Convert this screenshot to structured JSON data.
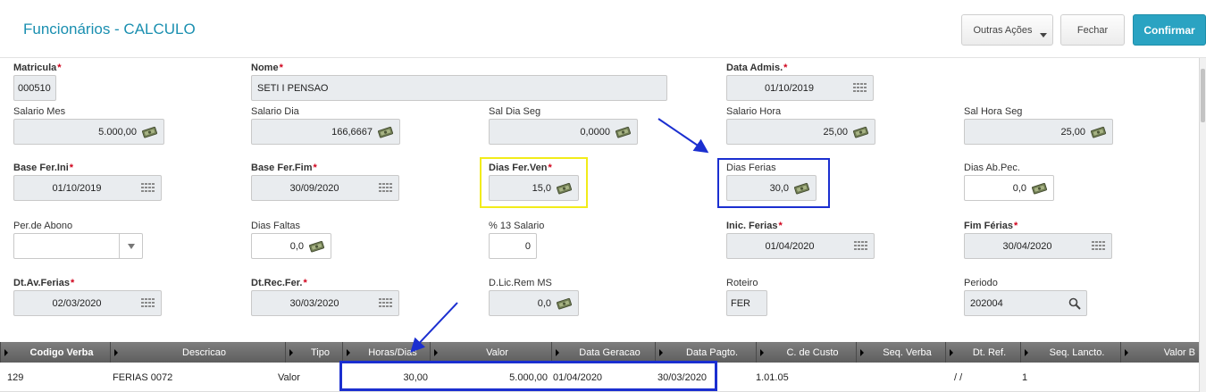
{
  "header": {
    "title": "Funcionários - CALCULO",
    "btn_outras": "Outras Ações",
    "btn_fechar": "Fechar",
    "btn_confirmar": "Confirmar",
    "accent": "#1a8fb0"
  },
  "fields": {
    "matricula": {
      "label": "Matricula",
      "value": "000510"
    },
    "nome": {
      "label": "Nome",
      "value": "SETI I PENSAO"
    },
    "data_admis": {
      "label": "Data Admis.",
      "value": "01/10/2019"
    },
    "salario_mes": {
      "label": "Salario Mes",
      "value": "5.000,00"
    },
    "salario_dia": {
      "label": "Salario Dia",
      "value": "166,6667"
    },
    "sal_dia_seg": {
      "label": "Sal Dia Seg",
      "value": "0,0000"
    },
    "salario_hora": {
      "label": "Salario Hora",
      "value": "25,00"
    },
    "sal_hora_seg": {
      "label": "Sal Hora Seg",
      "value": "25,00"
    },
    "base_fer_ini": {
      "label": "Base Fer.Ini",
      "value": "01/10/2019"
    },
    "base_fer_fim": {
      "label": "Base Fer.Fim",
      "value": "30/09/2020"
    },
    "dias_fer_ven": {
      "label": "Dias Fer.Ven",
      "value": "15,0"
    },
    "dias_ferias": {
      "label": "Dias Ferias",
      "value": "30,0"
    },
    "dias_ab_pec": {
      "label": "Dias Ab.Pec.",
      "value": "0,0"
    },
    "per_de_abono": {
      "label": "Per.de Abono",
      "value": ""
    },
    "dias_faltas": {
      "label": "Dias Faltas",
      "value": "0,0"
    },
    "pct_13_salario": {
      "label": "% 13 Salario",
      "value": "0"
    },
    "inic_ferias": {
      "label": "Inic. Ferias",
      "value": "01/04/2020"
    },
    "fim_ferias": {
      "label": "Fim Férias",
      "value": "30/04/2020"
    },
    "dt_av_ferias": {
      "label": "Dt.Av.Ferias",
      "value": "02/03/2020"
    },
    "dt_rec_fer": {
      "label": "Dt.Rec.Fer.",
      "value": "30/03/2020"
    },
    "d_lic_rem_ms": {
      "label": "D.Lic.Rem MS",
      "value": "0,0"
    },
    "roteiro": {
      "label": "Roteiro",
      "value": "FER"
    },
    "periodo": {
      "label": "Periodo",
      "value": "202004"
    }
  },
  "grid": {
    "columns": [
      "Codigo Verba",
      "Descricao",
      "Tipo",
      "Horas/Dias",
      "Valor",
      "Data Geracao",
      "Data Pagto.",
      "C. de Custo",
      "Seq. Verba",
      "Dt. Ref.",
      "Seq. Lancto.",
      "Valor B"
    ],
    "rows": [
      [
        "129",
        "FERIAS 0072",
        "Valor",
        "30,00",
        "5.000,00",
        "01/04/2020",
        "30/03/2020",
        "1.01.05",
        "",
        "/ /",
        "1",
        ""
      ]
    ]
  },
  "colors": {
    "highlight_yellow": "#f2ec19",
    "highlight_blue": "#1b2fd0",
    "required": "#d0021b"
  }
}
